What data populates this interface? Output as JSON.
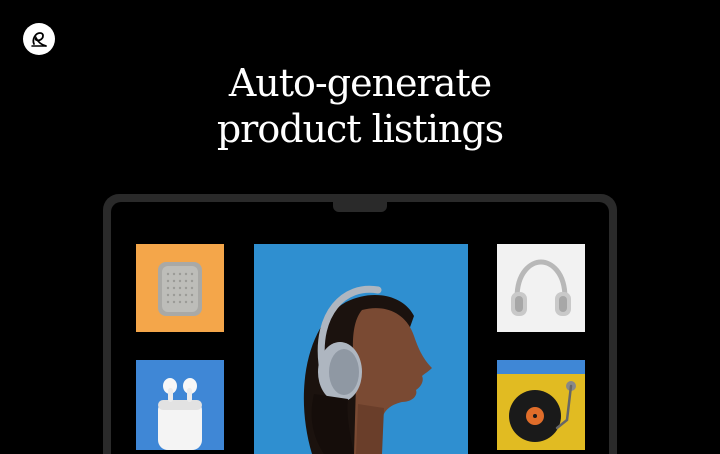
{
  "brand": {
    "logo_icon": "signature-logo-icon"
  },
  "headline": {
    "line1": "Auto-generate",
    "line2": "product listings"
  },
  "colors": {
    "background": "#000000",
    "text": "#ffffff",
    "laptop_frame": "#2a2a2a",
    "speaker_tile": "#f4a64a",
    "earbuds_tile": "#3f87d6",
    "headphones_tile": "#f2f2f2",
    "turntable_tile": "#3f87d6",
    "hero_background": "#2f8fd0"
  },
  "showcase": {
    "tiles": [
      {
        "icon": "speaker-icon"
      },
      {
        "icon": "earbuds-icon"
      },
      {
        "icon": "headphones-icon"
      },
      {
        "icon": "turntable-icon"
      }
    ],
    "hero_image": "woman-wearing-headphones-photo"
  }
}
